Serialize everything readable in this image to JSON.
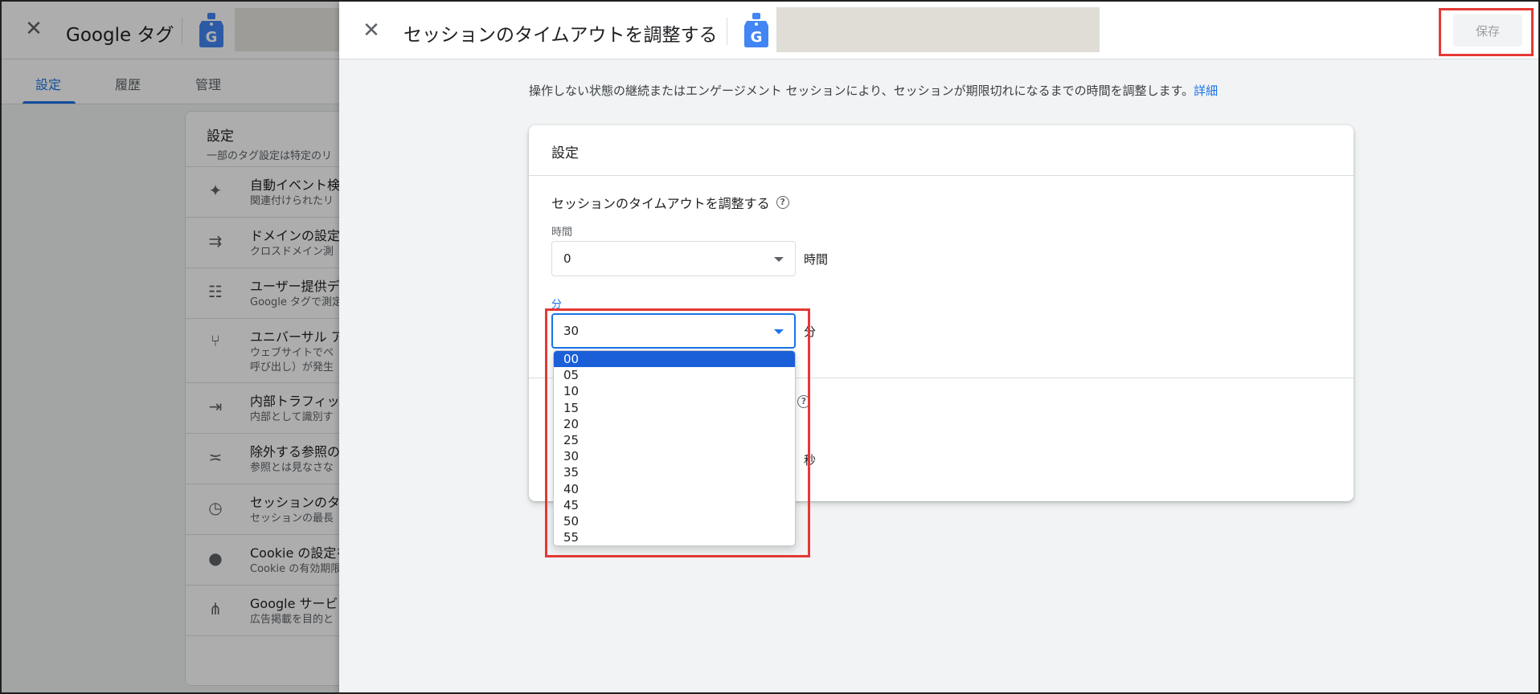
{
  "background": {
    "title": "Google タグ",
    "tabs": [
      {
        "label": "設定",
        "active": true
      },
      {
        "label": "履歴",
        "active": false
      },
      {
        "label": "管理",
        "active": false
      }
    ],
    "card": {
      "title": "設定",
      "subtitle": "一部のタグ設定は特定のリ"
    },
    "rows": [
      {
        "icon": "sparkle-icon",
        "title": "自動イベント検",
        "subtitle": "関連付けられたリ"
      },
      {
        "icon": "merge-arrows-icon",
        "title": "ドメインの設定",
        "subtitle": "クロスドメイン測"
      },
      {
        "icon": "user-data-icon",
        "title": "ユーザー提供デ",
        "subtitle": "Google タグで測定"
      },
      {
        "icon": "fork-icon",
        "title": "ユニバーサル ア",
        "subtitle": "ウェブサイトでペ",
        "subtitle2": "呼び出し）が発生"
      },
      {
        "icon": "login-icon",
        "title": "内部トラフィッ",
        "subtitle": "内部として識別す"
      },
      {
        "icon": "exclude-list-icon",
        "title": "除外する参照の",
        "subtitle": "参照とは見なさな"
      },
      {
        "icon": "clock-icon",
        "title": "セッションのタ",
        "subtitle": "セッションの最長"
      },
      {
        "icon": "cookie-icon",
        "title": "Cookie の設定を",
        "subtitle": "Cookie の有効期限"
      },
      {
        "icon": "network-icon",
        "title": "Google サービス",
        "subtitle": "広告掲載を目的と"
      }
    ]
  },
  "panel": {
    "title": "セッションのタイムアウトを調整する",
    "save_label": "保存",
    "description": "操作しない状態の継続またはエンゲージメント セッションにより、セッションが期限切れになるまでの時間を調整します。",
    "description_link": "詳細",
    "card": {
      "title": "設定",
      "section_title": "セッションのタイムアウトを調整する",
      "hours": {
        "label": "時間",
        "value": "0",
        "unit": "時間"
      },
      "minutes": {
        "label": "分",
        "value": "30",
        "unit": "分"
      },
      "seconds_unit": "秒"
    },
    "minute_options": [
      "00",
      "05",
      "10",
      "15",
      "20",
      "25",
      "30",
      "35",
      "40",
      "45",
      "50",
      "55"
    ],
    "highlighted_option": "00"
  },
  "colors": {
    "accent": "#1a73e8",
    "highlight_box": "#e53935",
    "selected_option": "#1a5fd8"
  }
}
